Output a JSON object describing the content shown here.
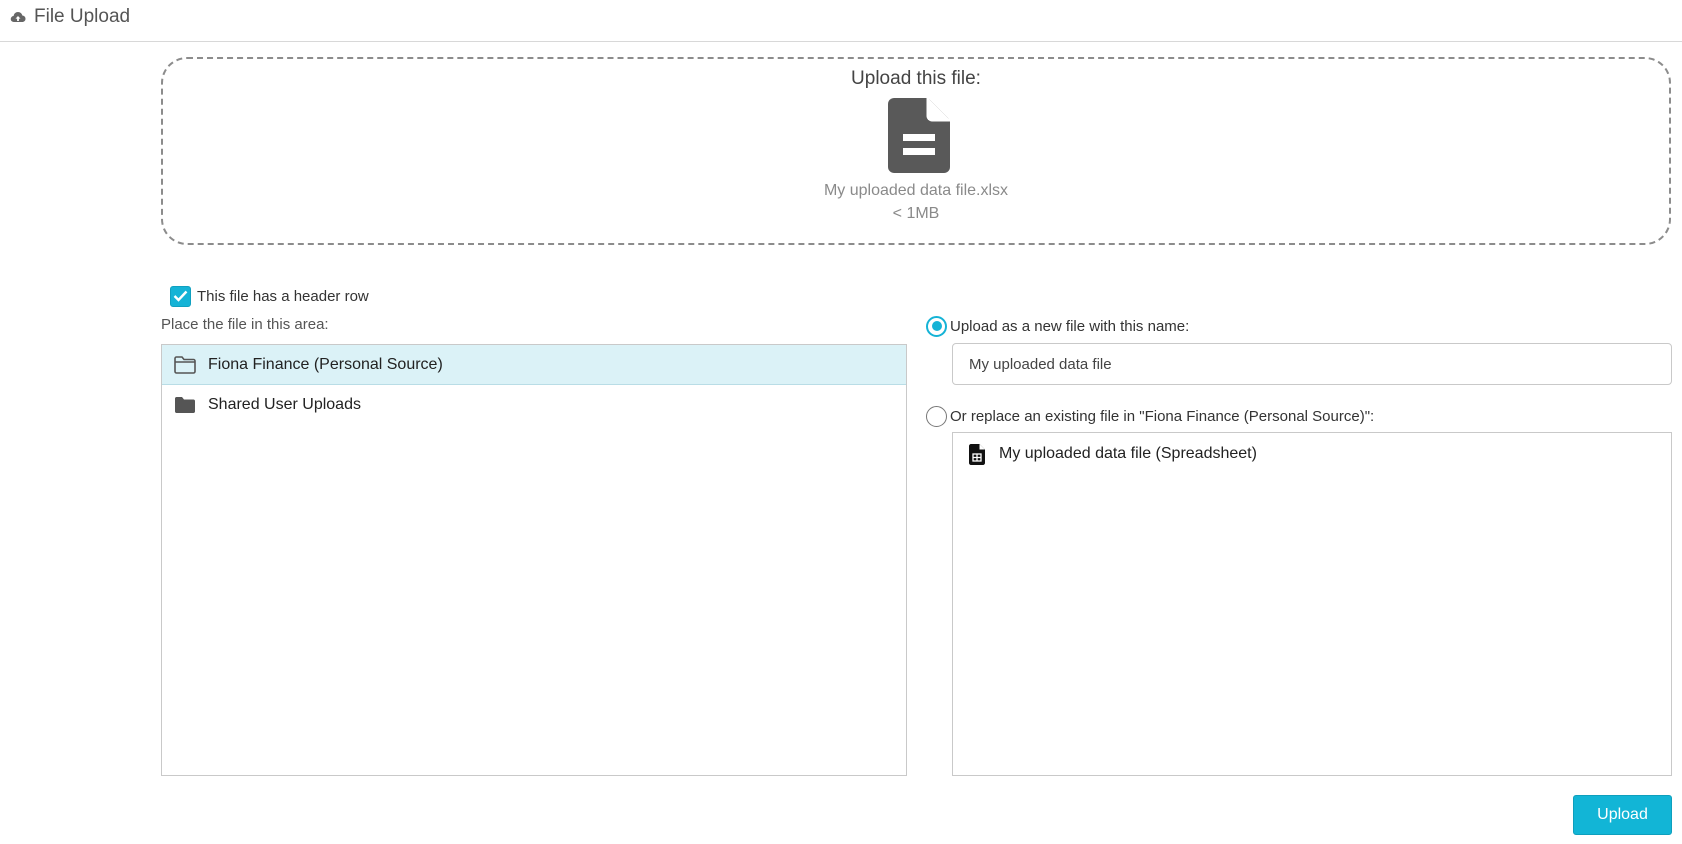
{
  "header": {
    "title": "File Upload",
    "icon": "cloud-upload-icon"
  },
  "dropzone": {
    "title": "Upload this file:",
    "icon": "document-icon",
    "file_name": "My uploaded data file.xlsx",
    "file_size": "< 1MB"
  },
  "options": {
    "header_row_label": "This file has a header row",
    "header_row_checked": true
  },
  "location": {
    "label": "Place the file in this area:",
    "folders": [
      {
        "label": "Fiona Finance (Personal Source)",
        "icon": "folder-outline-icon",
        "selected": true
      },
      {
        "label": "Shared User Uploads",
        "icon": "folder-filled-icon",
        "selected": false
      }
    ]
  },
  "upload_mode": {
    "new_file_label": "Upload as a new file with this name:",
    "new_file_selected": true,
    "new_file_name": "My uploaded data file",
    "replace_label": "Or replace an existing file in \"Fiona Finance (Personal Source)\":",
    "replace_selected": false,
    "existing_files": [
      {
        "label": "My uploaded data file (Spreadsheet)",
        "icon": "spreadsheet-icon"
      }
    ]
  },
  "actions": {
    "upload_label": "Upload"
  },
  "colors": {
    "accent": "#15b3d6",
    "selected_row": "#dbf2f7"
  }
}
